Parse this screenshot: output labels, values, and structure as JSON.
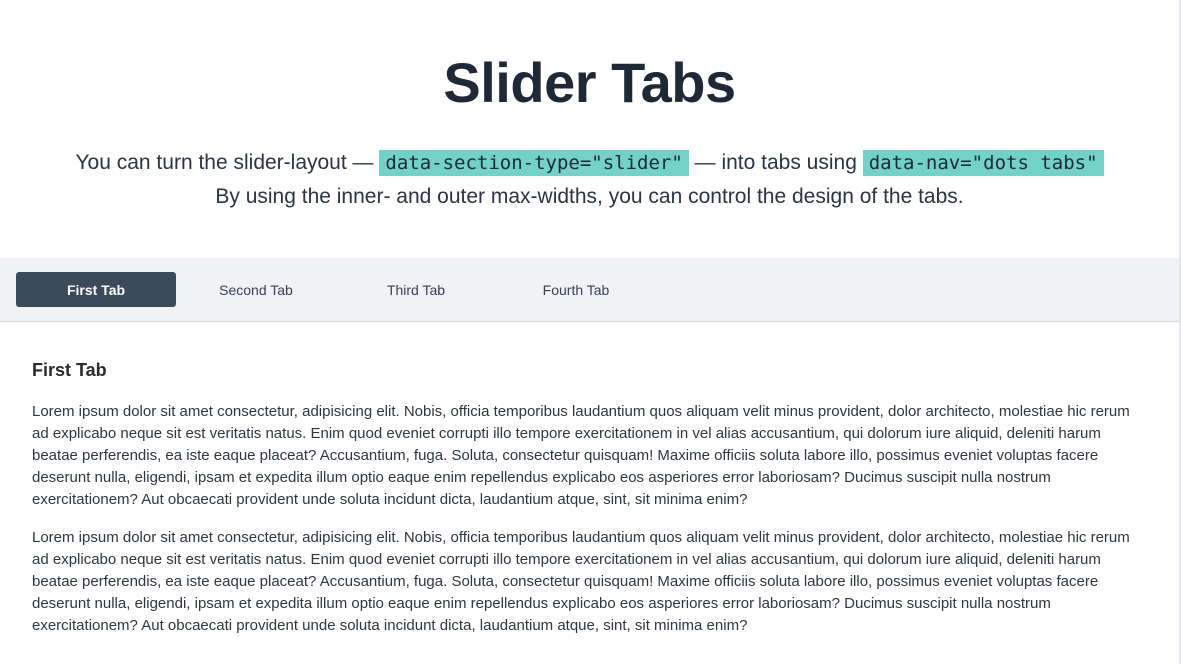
{
  "header": {
    "title": "Slider Tabs",
    "intro": {
      "part1": "You can turn the slider-layout — ",
      "code1": "data-section-type=\"slider\"",
      "part2": " — into tabs using ",
      "code2": "data-nav=\"dots tabs\"",
      "line2": "By using the inner- and outer max-widths, you can control the design of the tabs."
    }
  },
  "tabs": [
    {
      "label": "First Tab",
      "active": true
    },
    {
      "label": "Second Tab",
      "active": false
    },
    {
      "label": "Third Tab",
      "active": false
    },
    {
      "label": "Fourth Tab",
      "active": false
    }
  ],
  "panel": {
    "title": "First Tab",
    "paragraphs": [
      "Lorem ipsum dolor sit amet consectetur, adipisicing elit. Nobis, officia temporibus laudantium quos aliquam velit minus provident, dolor architecto, molestiae hic rerum ad explicabo neque sit est veritatis natus. Enim quod eveniet corrupti illo tempore exercitationem in vel alias accusantium, qui dolorum iure aliquid, deleniti harum beatae perferendis, ea iste eaque placeat? Accusantium, fuga. Soluta, consectetur quisquam! Maxime officiis soluta labore illo, possimus eveniet voluptas facere deserunt nulla, eligendi, ipsam et expedita illum optio eaque enim repellendus explicabo eos asperiores error laboriosam? Ducimus suscipit nulla nostrum exercitationem? Aut obcaecati provident unde soluta incidunt dicta, laudantium atque, sint, sit minima enim?",
      "Lorem ipsum dolor sit amet consectetur, adipisicing elit. Nobis, officia temporibus laudantium quos aliquam velit minus provident, dolor architecto, molestiae hic rerum ad explicabo neque sit est veritatis natus. Enim quod eveniet corrupti illo tempore exercitationem in vel alias accusantium, qui dolorum iure aliquid, deleniti harum beatae perferendis, ea iste eaque placeat? Accusantium, fuga. Soluta, consectetur quisquam! Maxime officiis soluta labore illo, possimus eveniet voluptas facere deserunt nulla, eligendi, ipsam et expedita illum optio eaque enim repellendus explicabo eos asperiores error laboriosam? Ducimus suscipit nulla nostrum exercitationem? Aut obcaecati provident unde soluta incidunt dicta, laudantium atque, sint, sit minima enim?"
    ]
  },
  "colors": {
    "active_tab_bg": "#3b4a5b",
    "tabbar_bg": "#f1f2f6",
    "code_highlight": "#72d1c9",
    "title_text": "#1e2836"
  }
}
